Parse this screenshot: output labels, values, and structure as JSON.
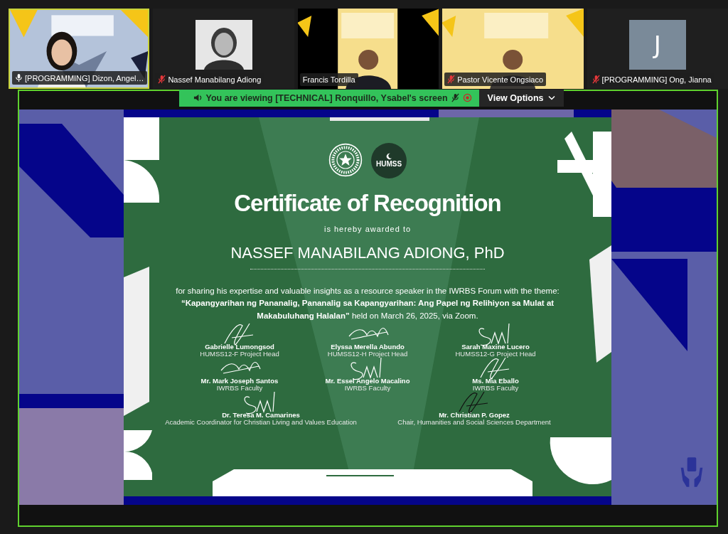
{
  "participants": [
    {
      "name": "[PROGRAMMING] Dizon, Angel…",
      "kind": "video",
      "mic_icon": true,
      "muted": false,
      "speaking": true
    },
    {
      "name": "Nassef Manabilang Adiong",
      "mic_icon": true,
      "muted": true,
      "speaking": false
    },
    {
      "name": "Francis Tordilla",
      "kind": "video",
      "mic_icon": false,
      "muted": false,
      "speaking": false
    },
    {
      "name": "Pastor Vicente Ongsiaco",
      "kind": "video",
      "mic_icon": true,
      "muted": true,
      "speaking": false
    },
    {
      "name": "[PROGRAMMING] Ong, Jianna",
      "kind": "avatar",
      "initial": "J",
      "mic_icon": true,
      "muted": true,
      "speaking": false
    }
  ],
  "share_banner": {
    "text": "You are viewing  [TECHNICAL] Ronquillo, Ysabel's screen",
    "view_options": "View Options"
  },
  "certificate": {
    "logo_text": "HUMSS",
    "title": "Certificate of Recognition",
    "subtitle": "is hereby awarded to",
    "recipient": "NASSEF MANABILANG ADIONG, PhD",
    "body": "for sharing his expertise and valuable insights as a resource speaker in the IWRBS Forum with the theme: **“Kapangyarihan ng Pananalig, Pananalig sa Kapangyarihan: Ang Papel ng Relihiyon sa Mulat at Makabuluhang Halalan”** held on March 26, 2025,  via Zoom.",
    "signatory_rows": [
      [
        {
          "name": "Gabrielle Lumongsod",
          "role": "HUMSS12-F Project Head"
        },
        {
          "name": "Elyssa Merella Abundo",
          "role": "HUMSS12-H Project Head"
        },
        {
          "name": "Sarah Maxine Lucero",
          "role": "HUMSS12-G Project Head"
        }
      ],
      [
        {
          "name": "Mr. Mark Joseph Santos",
          "role": "IWRBS Faculty"
        },
        {
          "name": "Mr. Essel Angelo Macalino",
          "role": "IWRBS Faculty"
        },
        {
          "name": "Ms. Mia Eballo",
          "role": "IWRBS Faculty"
        }
      ],
      [
        {
          "name": "Dr. Teresa M. Camarines",
          "role": "Academic Coordinator for Christian Living and Values Education"
        },
        {
          "name": "Mr. Christian P. Gopez",
          "role": "Chair, Humanities and Social Sciences  Department"
        }
      ]
    ]
  }
}
